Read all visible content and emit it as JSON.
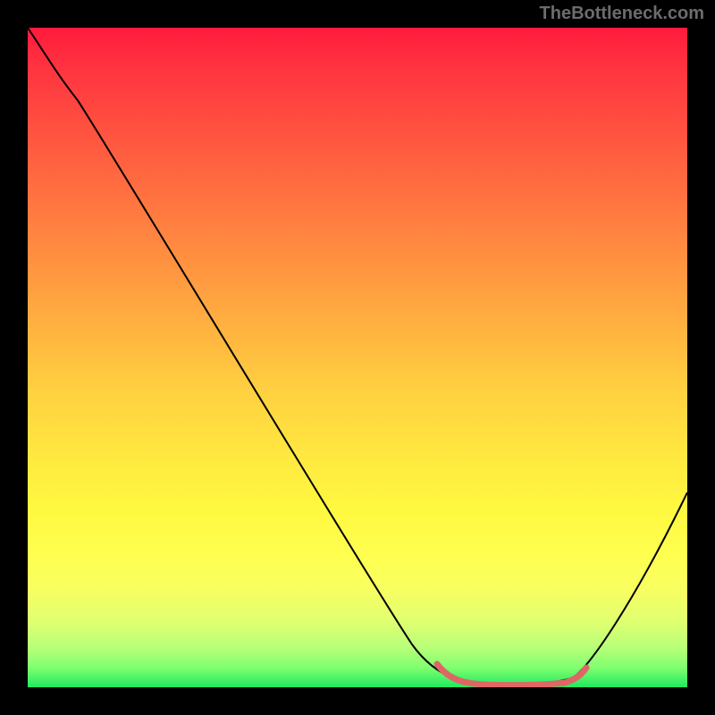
{
  "watermark": "TheBottleneck.com",
  "chart_data": {
    "type": "line",
    "title": "",
    "xlabel": "",
    "ylabel": "",
    "xlim": [
      0,
      100
    ],
    "ylim": [
      0,
      100
    ],
    "series": [
      {
        "name": "bottleneck-curve",
        "color": "#000000",
        "x": [
          0,
          5,
          10,
          20,
          30,
          40,
          50,
          58,
          63,
          68,
          73,
          78,
          85,
          92,
          100
        ],
        "y": [
          100,
          93,
          88,
          75,
          61,
          48,
          34,
          20,
          10,
          3,
          0,
          0,
          2,
          12,
          30
        ]
      },
      {
        "name": "optimal-range",
        "color": "#e36c6c",
        "x": [
          63,
          68,
          73,
          78,
          83
        ],
        "y": [
          3.5,
          0.5,
          0,
          0.5,
          2.5
        ]
      }
    ],
    "gradient": {
      "top_color": "#ff1a3c",
      "mid_color": "#ffe840",
      "bottom_color": "#20e860"
    }
  }
}
